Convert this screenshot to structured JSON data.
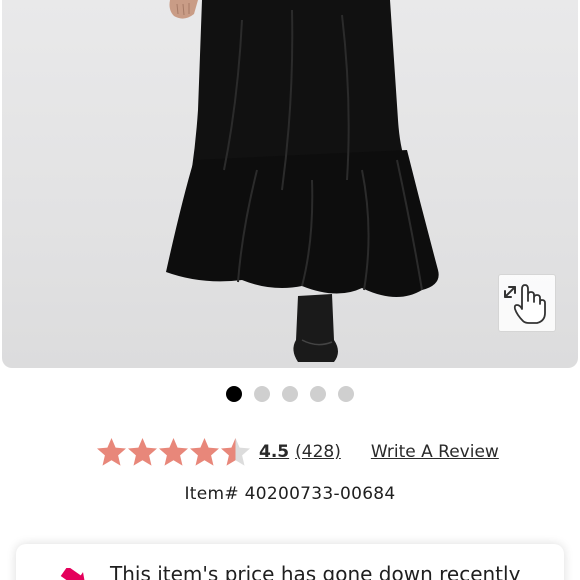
{
  "product": {
    "image_alt": "Black tiered maxi skirt",
    "zoom_icon": "hand-pinch-zoom-icon"
  },
  "carousel": {
    "total": 5,
    "active": 1
  },
  "rating": {
    "value": "4.5",
    "count": "(428)",
    "stars": 4.5,
    "max_stars": 5,
    "star_color": "#e8877a",
    "star_empty_color": "#dcdcdc",
    "write_review_label": "Write A Review"
  },
  "item": {
    "number_text": "Item# 40200733-00684"
  },
  "price_alert": {
    "text": "This item's price has gone down recently",
    "icon": "price-drop-arrow-icon",
    "accent": "#e4005b"
  }
}
